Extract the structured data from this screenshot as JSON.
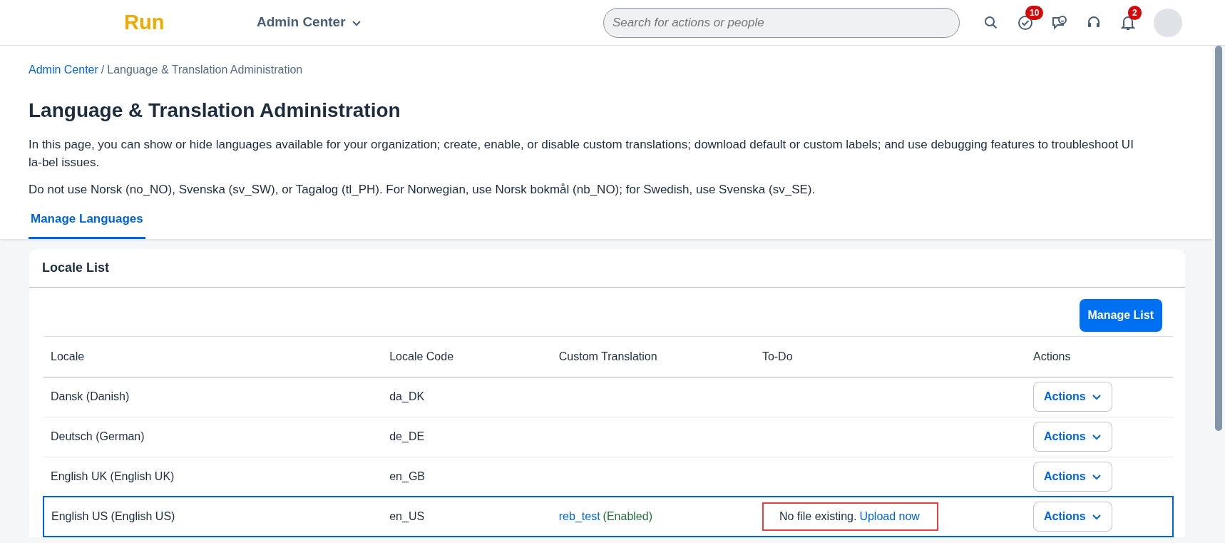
{
  "header": {
    "logo": "Run",
    "menu": {
      "label": "Admin Center"
    },
    "search": {
      "placeholder": "Search for actions or people"
    },
    "icons": [
      {
        "kind": "search"
      },
      {
        "kind": "tasks",
        "badge": "10"
      },
      {
        "kind": "chat"
      },
      {
        "kind": "support"
      },
      {
        "kind": "bell",
        "badge": "2"
      },
      {
        "kind": "avatar"
      }
    ]
  },
  "breadcrumb": {
    "separator": "/",
    "items": [
      {
        "label": "Admin Center",
        "link": true
      },
      {
        "label": "Language & Translation Administration",
        "link": false
      }
    ]
  },
  "title": "Language & Translation Administration",
  "paragraphs": [
    "In this page, you can show or hide languages available for your organization; create, enable, or disable custom translations; download default or custom labels; and use debugging features to troubleshoot UI la-bel issues.",
    "Do not use Norsk (no_NO), Svenska (sv_SW), or Tagalog (tl_PH). For Norwegian, use Norsk bokmål (nb_NO); for Swedish, use Svenska (sv_SE)."
  ],
  "tabs": [
    {
      "label": "Manage Languages",
      "selected": true
    }
  ],
  "card": {
    "title": "Locale List",
    "button": "Manage List",
    "table": {
      "columns": [
        "Locale",
        "Locale Code",
        "Custom Translation",
        "To-Do",
        "Actions"
      ],
      "rows": [
        {
          "locale": "Dansk (Danish)",
          "code": "da_DK",
          "selected": false,
          "action": "Actions"
        },
        {
          "locale": "Deutsch (German)",
          "code": "de_DE",
          "selected": false,
          "action": "Actions"
        },
        {
          "locale": "English UK (English UK)",
          "code": "en_GB",
          "selected": false,
          "action": "Actions"
        },
        {
          "locale": "English US (English US)",
          "code": "en_US",
          "selected": true,
          "translation": {
            "name": "reb_test",
            "status": "(Enabled)"
          },
          "todo": {
            "text": "No file existing.",
            "link": "Upload now",
            "highlighted": true
          },
          "action": "Actions"
        }
      ]
    }
  }
}
